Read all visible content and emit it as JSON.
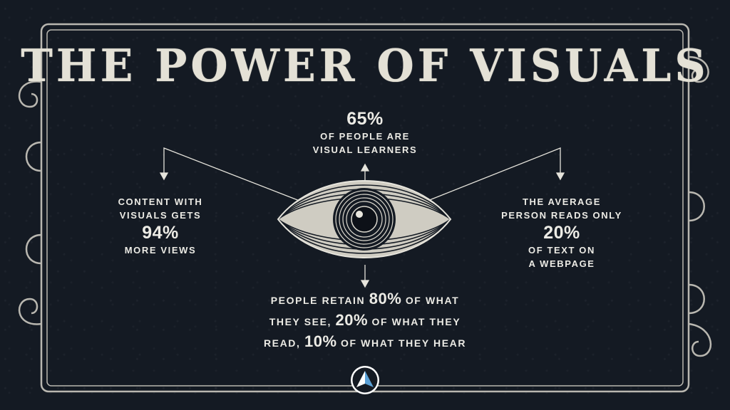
{
  "title": "THE POWER OF VISUALS",
  "stats": {
    "top": {
      "big": "65%",
      "line1": "OF PEOPLE ARE",
      "line2": "VISUAL LEARNERS"
    },
    "left": {
      "line1": "CONTENT WITH",
      "line2": "VISUALS GETS",
      "big": "94%",
      "line3": "MORE VIEWS"
    },
    "right": {
      "line1": "THE AVERAGE",
      "line2": "PERSON READS ONLY",
      "big": "20%",
      "line3": "OF TEXT ON",
      "line4": "A WEBPAGE"
    },
    "bottom": {
      "pre1": "PEOPLE RETAIN",
      "big1": "80%",
      "post1": "OF WHAT",
      "pre2": "THEY SEE,",
      "big2": "20%",
      "post2": "OF WHAT THEY",
      "pre3": "READ,",
      "big3": "10%",
      "post3": "OF WHAT THEY HEAR"
    }
  },
  "icons": {
    "eye": "eye-engraving-icon",
    "logo": "triangle-logo-icon"
  },
  "colors": {
    "background": "#141a23",
    "text": "#ecebe5",
    "frame": "#b9b7b0"
  }
}
